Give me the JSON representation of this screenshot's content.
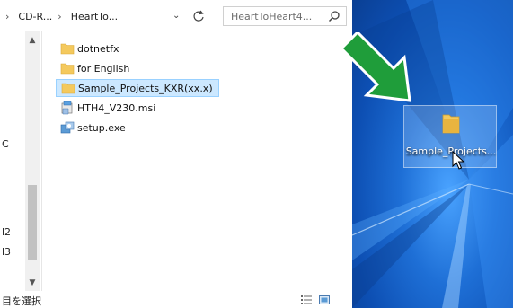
{
  "address": {
    "seg1": "CD-R...",
    "seg2": "HeartTo...",
    "sep": "›",
    "lead": "›"
  },
  "search": {
    "placeholder": "HeartToHeart4..."
  },
  "navpane": {
    "frags": [
      "C",
      "l2",
      "l3"
    ]
  },
  "files": [
    {
      "name": "dotnetfx",
      "icon": "folder-icon"
    },
    {
      "name": "for English",
      "icon": "folder-icon"
    },
    {
      "name": "Sample_Projects_KXR(xx.x)",
      "icon": "folder-icon",
      "selected": true
    },
    {
      "name": "HTH4_V230.msi",
      "icon": "msi-installer-icon"
    },
    {
      "name": "setup.exe",
      "icon": "setup-exe-icon"
    }
  ],
  "status": {
    "text": "目を選択"
  },
  "desktop": {
    "item_label": "Sample_Projects..."
  },
  "colors": {
    "arrow": "#1f9d3a",
    "selection": "#cce8ff",
    "folder": "#f4c95d",
    "desktop": "#1e6fd6"
  }
}
